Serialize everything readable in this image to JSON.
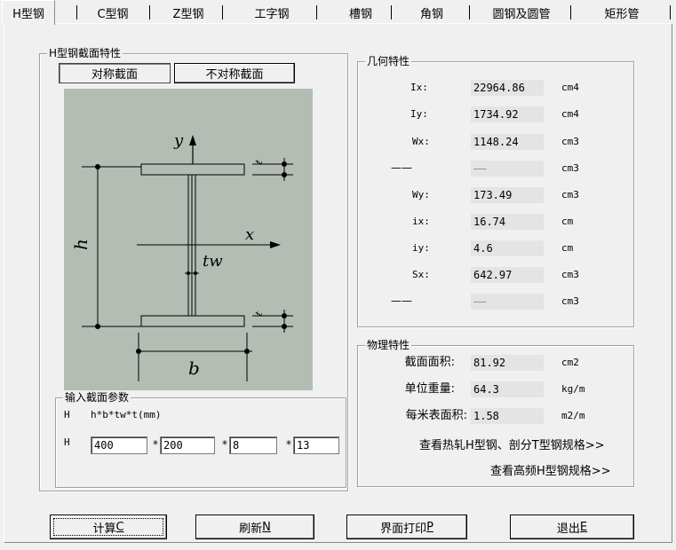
{
  "tabs": [
    {
      "label": "H型钢"
    },
    {
      "label": "C型钢"
    },
    {
      "label": "Z型钢"
    },
    {
      "label": "工字钢"
    },
    {
      "label": "槽钢"
    },
    {
      "label": "角钢"
    },
    {
      "label": "圆钢及圆管"
    },
    {
      "label": "矩形管"
    }
  ],
  "section": {
    "title": "H型钢截面特性",
    "symmetric_label": "对称截面",
    "asymmetric_label": "不对称截面"
  },
  "diagram": {
    "y_axis": "y",
    "x_axis": "x",
    "height_label": "h",
    "width_label": "b",
    "web_label": "tw",
    "flange_label": "t"
  },
  "input": {
    "title": "输入截面参数",
    "row1_prefix": "H",
    "formula": "h*b*tw*t(mm)",
    "row2_prefix": "H",
    "h": "400",
    "b": "200",
    "tw": "8",
    "t": "13",
    "sep": "*"
  },
  "geometry": {
    "title": "几何特性",
    "rows": [
      {
        "label": "Ix:",
        "value": "22964.86",
        "unit": "cm4"
      },
      {
        "label": "Iy:",
        "value": "1734.92",
        "unit": "cm4"
      },
      {
        "label": "Wx:",
        "value": "1148.24",
        "unit": "cm3"
      },
      {
        "label": "——",
        "value": "——",
        "unit": "cm3"
      },
      {
        "label": "Wy:",
        "value": "173.49",
        "unit": "cm3"
      },
      {
        "label": "ix:",
        "value": "16.74",
        "unit": "cm"
      },
      {
        "label": "iy:",
        "value": "4.6",
        "unit": "cm"
      },
      {
        "label": "Sx:",
        "value": "642.97",
        "unit": "cm3"
      },
      {
        "label": "——",
        "value": "——",
        "unit": "cm3"
      }
    ]
  },
  "physics": {
    "title": "物理特性",
    "rows": [
      {
        "label": "截面面积:",
        "value": "81.92",
        "unit": "cm2"
      },
      {
        "label": "单位重量:",
        "value": "64.3",
        "unit": "kg/m"
      },
      {
        "label": "每米表面积:",
        "value": "1.58",
        "unit": "m2/m"
      }
    ],
    "link1": "查看热轧H型钢、剖分T型钢规格>>",
    "link2": "查看高频H型钢规格>>"
  },
  "buttons": {
    "calc": {
      "text": "计算",
      "key": "C"
    },
    "refresh": {
      "text": "刷新",
      "key": "N"
    },
    "print": {
      "text": "界面打印",
      "key": "P"
    },
    "exit": {
      "text": "退出",
      "key": "E"
    }
  }
}
